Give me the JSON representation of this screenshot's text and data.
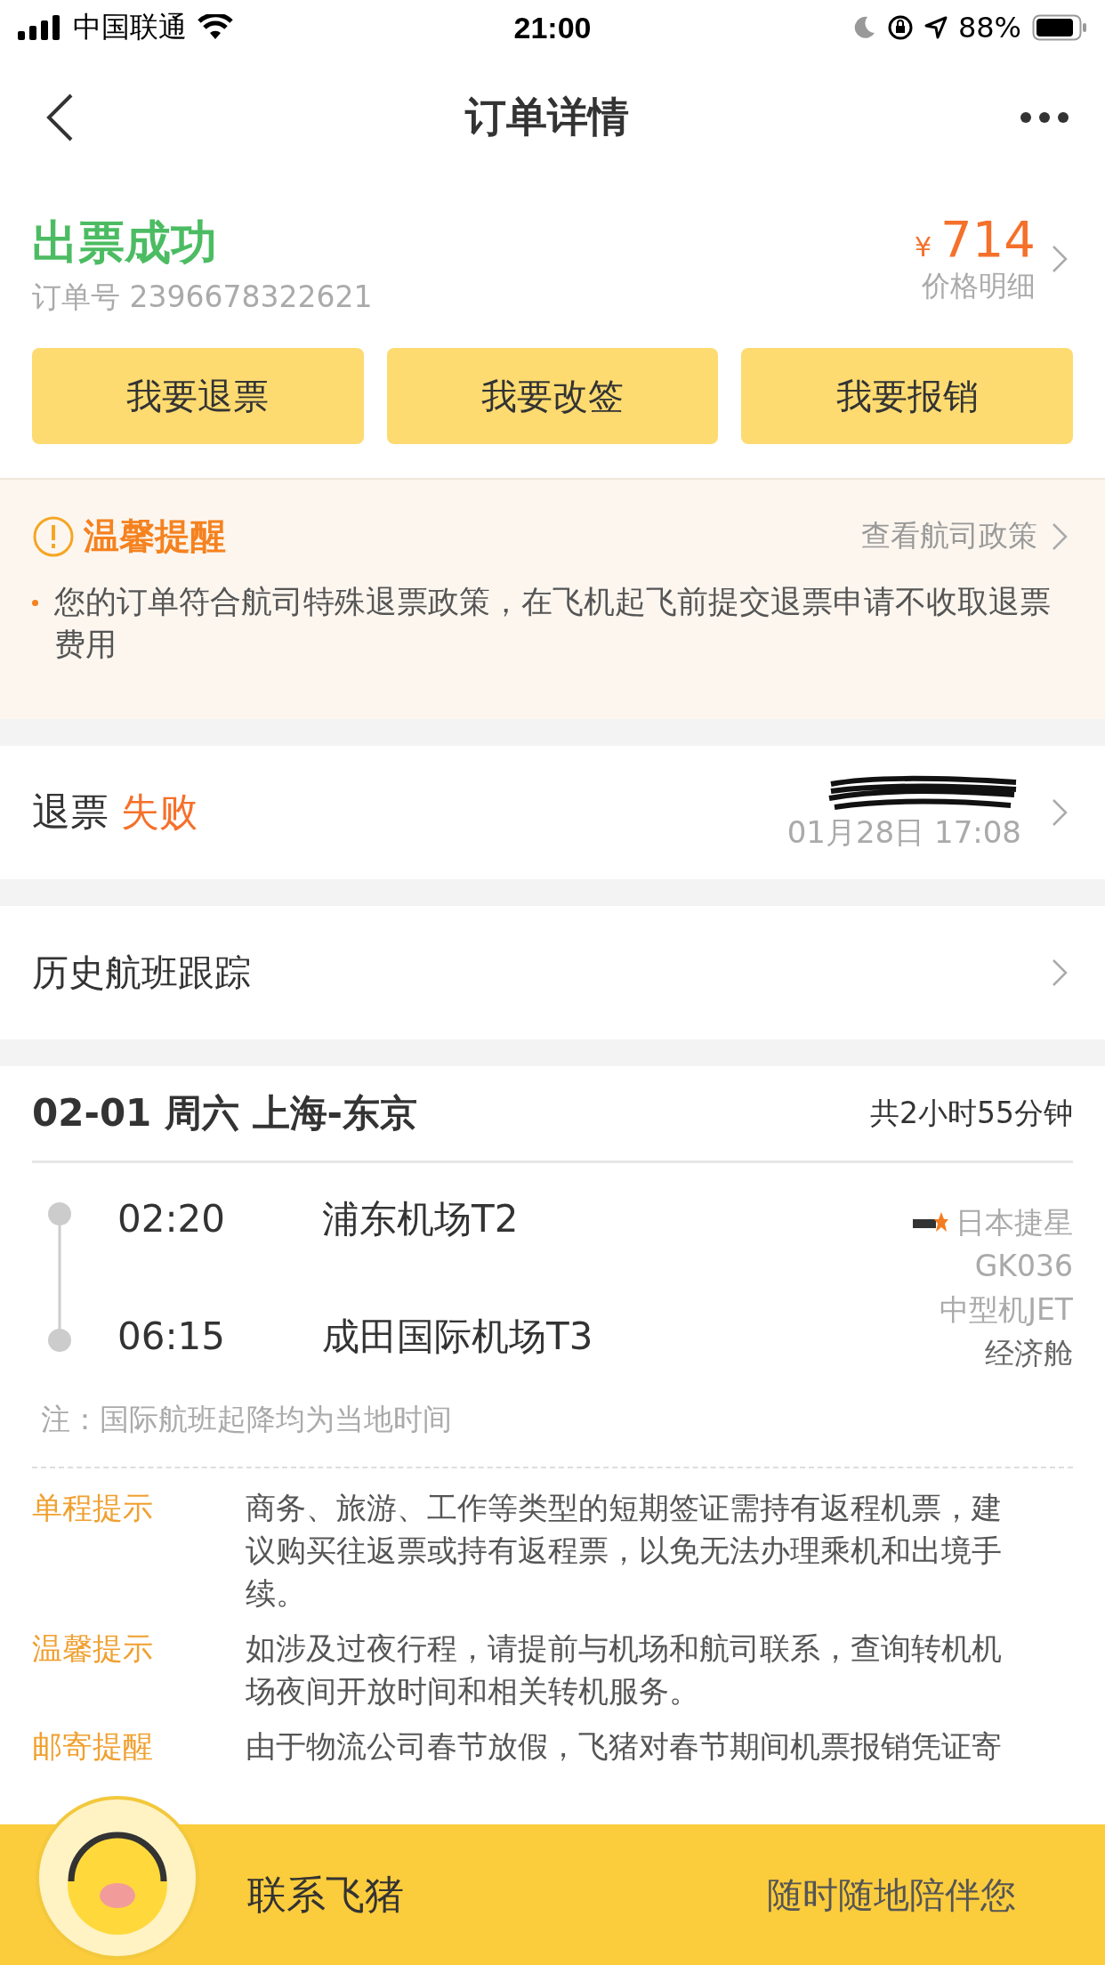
{
  "status_bar": {
    "carrier": "中国联通",
    "time": "21:00",
    "battery": "88%"
  },
  "nav": {
    "title": "订单详情"
  },
  "order": {
    "status": "出票成功",
    "order_label": "订单号",
    "order_number": "2396678322621",
    "currency": "¥",
    "price": "714",
    "price_detail": "价格明细"
  },
  "actions": [
    "我要退票",
    "我要改签",
    "我要报销"
  ],
  "notice": {
    "title": "温馨提醒",
    "link": "查看航司政策",
    "items": [
      "您的订单符合航司特殊退票政策，在飞机起飞前提交退票申请不收取退票费用"
    ]
  },
  "refund": {
    "label": "退票",
    "status": "失败",
    "time": "01月28日 17:08"
  },
  "history": {
    "label": "历史航班跟踪"
  },
  "flight": {
    "date": "02-01 周六 上海-东京",
    "duration": "共2小时55分钟",
    "departure": {
      "time": "02:20",
      "airport": "浦东机场T2"
    },
    "arrival": {
      "time": "06:15",
      "airport": "成田国际机场T3"
    },
    "airline": "日本捷星",
    "flight_no": "GK036",
    "aircraft": "中型机JET",
    "cabin": "经济舱",
    "note": "注：国际航班起降均为当地时间"
  },
  "tips": [
    {
      "label": "单程提示",
      "text": "商务、旅游、工作等类型的短期签证需持有返程机票，建议购买往返票或持有返程票，以免无法办理乘机和出境手续。"
    },
    {
      "label": "温馨提示",
      "text": "如涉及过夜行程，请提前与机场和航司联系，查询转机机场夜间开放时间和相关转机服务。"
    },
    {
      "label": "邮寄提醒",
      "text": "由于物流公司春节放假，飞猪对春节期间机票报销凭证寄"
    }
  ],
  "contact": {
    "label": "联系飞猪",
    "slogan": "随时随地陪伴您"
  }
}
